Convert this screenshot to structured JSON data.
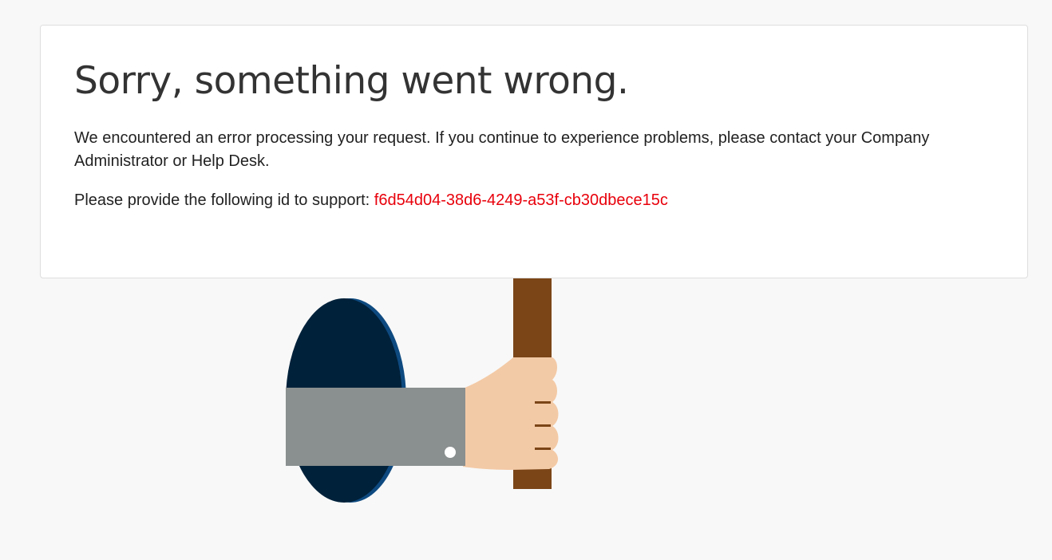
{
  "error": {
    "title": "Sorry, something went wrong.",
    "message": "We encountered an error processing your request. If you continue to experience problems, please contact your Company Administrator or Help Desk.",
    "support_prefix": "Please provide the following id to support:",
    "support_id": "f6d54d04-38d6-4249-a53f-cb30dbece15c"
  },
  "colors": {
    "background": "#f8f8f8",
    "card": "#ffffff",
    "support_id": "#e8000b",
    "hole_dark": "#00213a",
    "hole_rim": "#0e4a80",
    "sleeve": "#8a8f8f",
    "hand": "#f3caa6",
    "stick": "#7b4517"
  },
  "illustration": {
    "icon": "hand-holding-sign-icon"
  }
}
